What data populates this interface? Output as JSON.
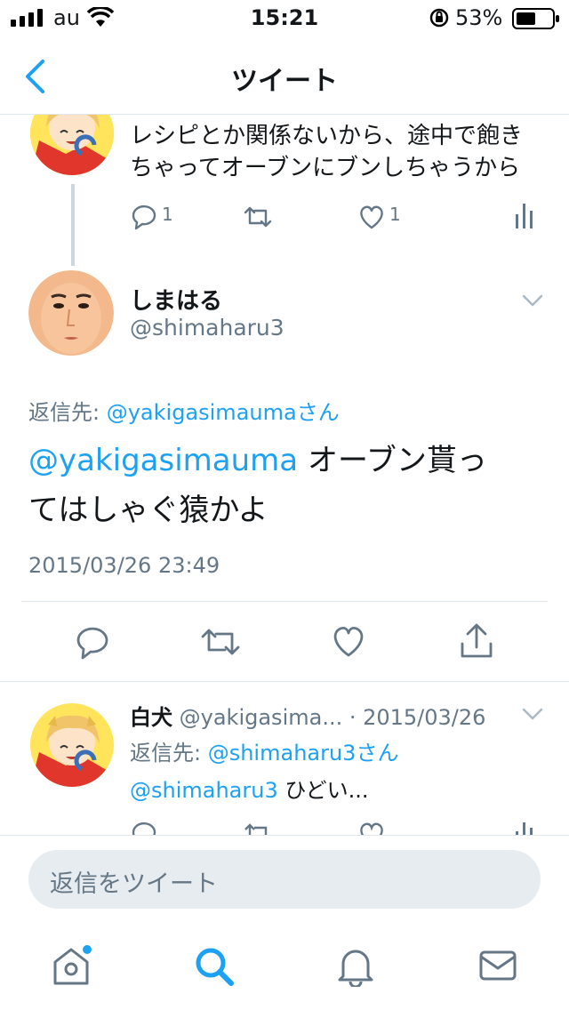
{
  "status_bar": {
    "carrier": "au",
    "time": "15:21",
    "battery": "53%"
  },
  "nav": {
    "title": "ツイート"
  },
  "parent_tweet": {
    "text_line1": "レシピとか関係ないから、途中で飽き",
    "text_line2": "ちゃってオーブンにブンしちゃうから",
    "reply_count": "1",
    "like_count": "1"
  },
  "main_tweet": {
    "display_name": "しまはる",
    "handle": "@shimaharu3",
    "reply_to_prefix": "返信先: ",
    "reply_to_user": "@yakigasimaumaさん",
    "mention": "@yakigasimauma",
    "text_rest_line1": " オーブン貰っ",
    "text_line2": "てはしゃぐ猿かよ",
    "timestamp": "2015/03/26 23:49"
  },
  "reply_tweet": {
    "display_name": "白犬",
    "handle": "@yakigasima...",
    "date": "· 2015/03/26",
    "reply_to_prefix": "返信先: ",
    "reply_to_user": "@shimaharu3さん",
    "mention": "@shimaharu3",
    "text": " ひどい..."
  },
  "reply_input": {
    "placeholder": "返信をツイート"
  },
  "colors": {
    "accent": "#1da1f2",
    "grey": "#657786",
    "divider": "#e1e8ed"
  }
}
